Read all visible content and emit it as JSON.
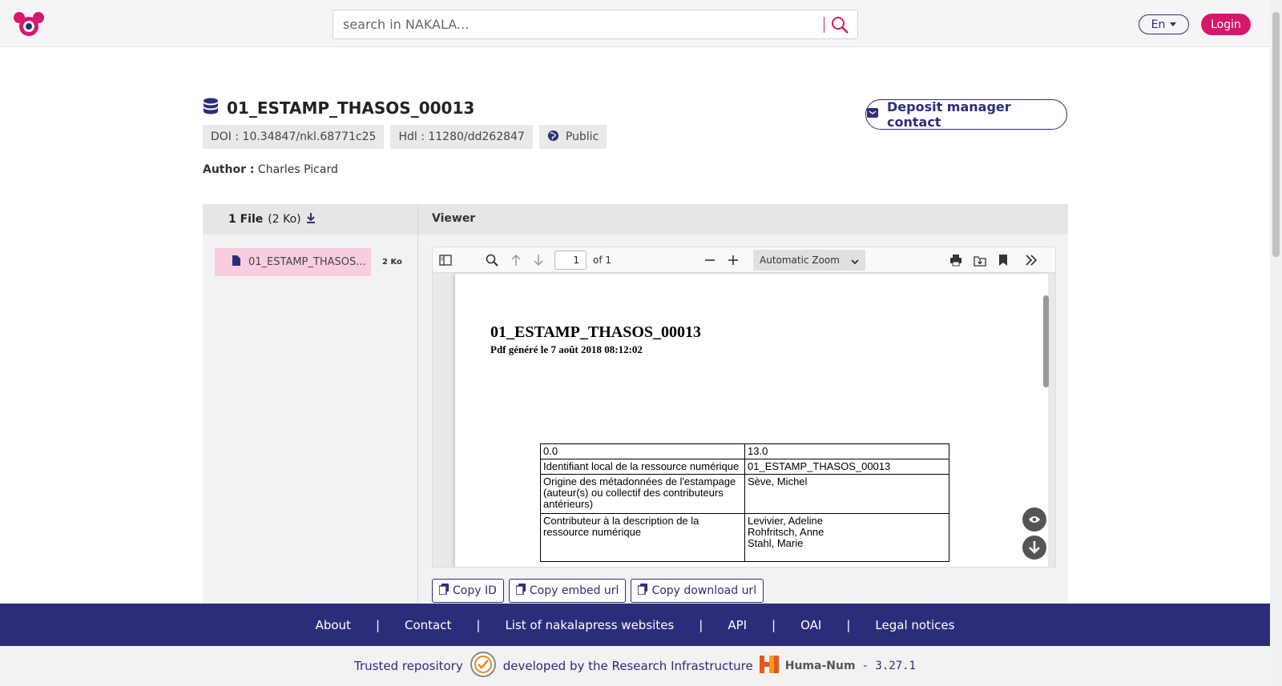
{
  "header": {
    "search_placeholder": "search in NAKALA...",
    "lang_label": "En",
    "login_label": "Login"
  },
  "record": {
    "title": "01_ESTAMP_THASOS_00013",
    "doi": "DOI : 10.34847/nkl.68771c25",
    "hdl": "Hdl : 11280/dd262847",
    "visibility": "Public",
    "contact_label": "Deposit manager contact",
    "author_label": "Author :",
    "author_name": "Charles Picard"
  },
  "files": {
    "count_label": "1 File",
    "total_size": "(2 Ko)",
    "items": [
      {
        "name": "01_ESTAMP_THASOS...",
        "size": "2 Ko"
      }
    ]
  },
  "viewer": {
    "heading": "Viewer",
    "page_current": "1",
    "page_of": "of 1",
    "zoom_label": "Automatic Zoom",
    "doc_title": "01_ESTAMP_THASOS_00013",
    "doc_subtitle": "Pdf généré le 7 août 2018 08:12:02",
    "table": [
      [
        "0.0",
        "13.0"
      ],
      [
        "Identifiant local de la ressource numérique",
        "01_ESTAMP_THASOS_00013"
      ],
      [
        "Origine des métadonnées de l'estampage (auteur(s) ou collectif des contributeurs antérieurs)",
        "Sève, Michel"
      ],
      [
        "Contributeur à la description de la ressource numérique",
        "Levivier, Adeline\nRohfritsch, Anne\nStahl, Marie"
      ]
    ]
  },
  "copy_buttons": {
    "id": "Copy ID",
    "embed": "Copy embed url",
    "download": "Copy download url"
  },
  "footer": {
    "links": [
      "About",
      "Contact",
      "List of nakalapress websites",
      "API",
      "OAI",
      "Legal notices"
    ],
    "trusted": "Trusted repository",
    "developed": "developed by the Research Infrastructure",
    "huma_num": "Huma-Num",
    "version": "- 3.27.1"
  },
  "colors": {
    "brand": "#2c2d7a",
    "accent": "#d6176b"
  }
}
